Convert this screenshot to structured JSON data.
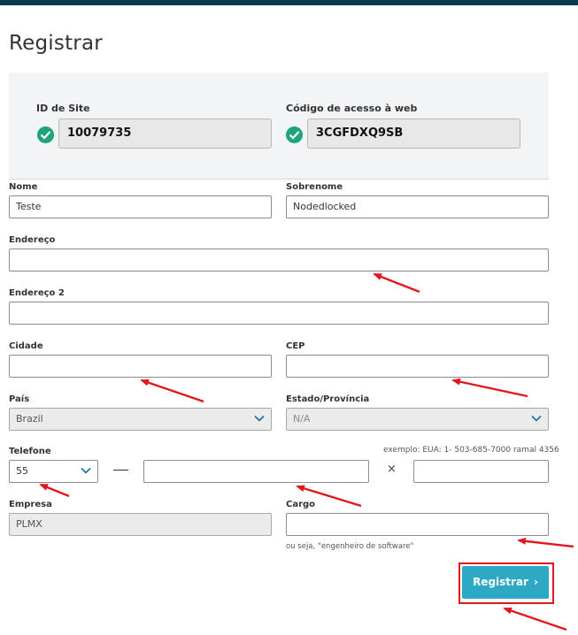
{
  "page": {
    "title": "Registrar"
  },
  "site": {
    "site_id_label": "ID de Site",
    "site_id_value": "10079735",
    "web_code_label": "Código de acesso à web",
    "web_code_value": "3CGFDXQ9SB"
  },
  "form": {
    "nome_label": "Nome",
    "nome_value": "Teste",
    "sobrenome_label": "Sobrenome",
    "sobrenome_value": "Nodedlocked",
    "endereco_label": "Endereço",
    "endereco_value": "",
    "endereco2_label": "Endereço 2",
    "endereco2_value": "",
    "cidade_label": "Cidade",
    "cidade_value": "",
    "cep_label": "CEP",
    "cep_value": "",
    "pais_label": "País",
    "pais_value": "Brazil",
    "estado_label": "Estado/Província",
    "estado_value": "N/A",
    "telefone_label": "Telefone",
    "telefone_hint": "exemplo: EUA: 1- 503-685-7000 ramal 4356",
    "telefone_code": "55",
    "telefone_number": "",
    "telefone_ext": "",
    "telefone_separator": "×",
    "empresa_label": "Empresa",
    "empresa_value": "PLMX",
    "cargo_label": "Cargo",
    "cargo_value": "",
    "cargo_hint": "ou seja, \"engenheiro de software\""
  },
  "actions": {
    "register_label": "Registrar",
    "register_arrow": "›"
  },
  "colors": {
    "topbar": "#0d3a53",
    "accent": "#2ea9c5",
    "check": "#1fa37a",
    "annotation": "#e0191f"
  },
  "icons": [
    "check-circle-icon",
    "chevron-down-icon",
    "chevron-right-icon",
    "red-arrow-annotation"
  ]
}
